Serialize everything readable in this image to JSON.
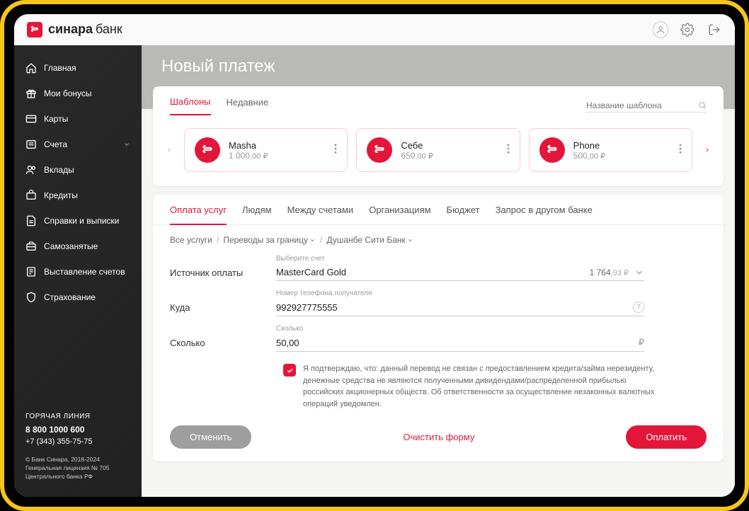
{
  "brand": {
    "name_bold": "синара",
    "name_light": "банк"
  },
  "sidebar": {
    "items": [
      {
        "label": "Главная"
      },
      {
        "label": "Мои бонусы"
      },
      {
        "label": "Карты"
      },
      {
        "label": "Счета"
      },
      {
        "label": "Вклады"
      },
      {
        "label": "Кредиты"
      },
      {
        "label": "Справки и выписки"
      },
      {
        "label": "Самозанятые"
      },
      {
        "label": "Выставление счетов"
      },
      {
        "label": "Страхование"
      }
    ],
    "hotline_title": "ГОРЯЧАЯ ЛИНИЯ",
    "hotline_phone1": "8 800 1000 600",
    "hotline_phone2": "+7 (343) 355-75-75",
    "legal1": "© Банк Синара, 2018-2024",
    "legal2": "Генеральная лицензия № 705",
    "legal3": "Центрального банка РФ"
  },
  "page_title": "Новый платеж",
  "templates": {
    "tab_templates": "Шаблоны",
    "tab_recent": "Недавние",
    "search_placeholder": "Название шаблона",
    "cards": [
      {
        "name": "Masha",
        "amount_int": "1 000",
        "amount_cents": ",00 ₽"
      },
      {
        "name": "Себе",
        "amount_int": "650",
        "amount_cents": ",00 ₽"
      },
      {
        "name": "Phone",
        "amount_int": "500",
        "amount_cents": ",00 ₽"
      }
    ]
  },
  "svc_tabs": [
    "Оплата услуг",
    "Людям",
    "Между счетами",
    "Организациям",
    "Бюджет",
    "Запрос в другом банке"
  ],
  "breadcrumb": {
    "root": "Все услуги",
    "l1": "Переводы за границу",
    "l2": "Душанбе Сити Банк"
  },
  "form": {
    "source_label": "Источник оплаты",
    "source_caption": "Выберите счет",
    "source_value": "MasterCard Gold",
    "source_balance_int": "1 764",
    "source_balance_cents": ",93 ₽",
    "dest_label": "Куда",
    "dest_caption": "Номер телефона получателя",
    "dest_value": "992927775555",
    "amount_label": "Сколько",
    "amount_caption": "Сколько",
    "amount_value": "50,00",
    "confirm_text": "Я подтверждаю, что: данный перевод не связан с предоставлением кредита/займа нерезиденту, денежные средства не являются полученными дивидендами/распределенной прибылью российских акционерных обществ. Об ответственности за осуществление незаконных валютных операций уведомлен."
  },
  "actions": {
    "cancel": "Отменить",
    "clear": "Очистить форму",
    "pay": "Оплатить"
  }
}
